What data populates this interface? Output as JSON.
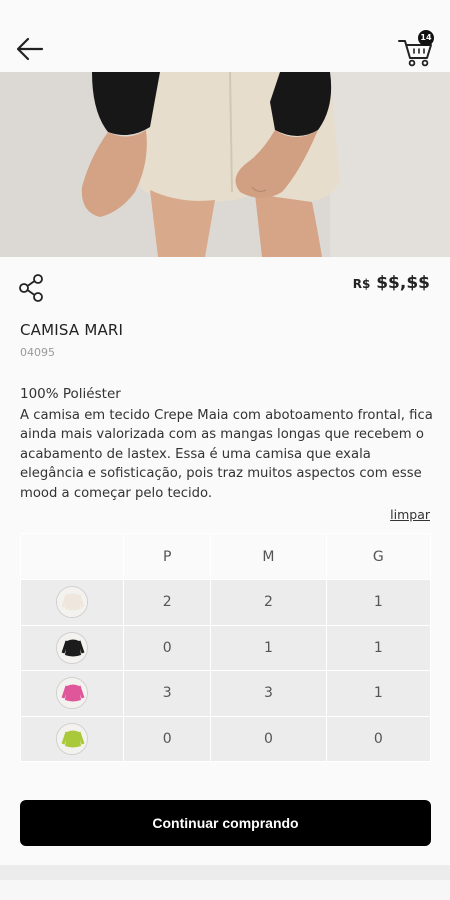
{
  "header": {
    "back_icon": "arrow-left-icon",
    "cart_icon": "shopping-cart-icon",
    "cart_count": "14"
  },
  "gallery": {
    "slide_count": 5,
    "active_index": 1
  },
  "product": {
    "price_currency": "R$",
    "price_value": "$$,$$",
    "name": "CAMISA MARI",
    "code": "04095",
    "material": "100% Poliéster",
    "description": "A camisa em tecido Crepe Maia com abotoamento frontal, fica ainda mais valorizada com as mangas longas que recebem o acabamento de lastex. Essa é uma camisa que exala elegância e sofisticação, pois traz muitos aspectos com esse mood a começar pelo tecido."
  },
  "size_grid": {
    "clear_label": "limpar",
    "headers": [
      "P",
      "M",
      "G"
    ],
    "rows": [
      {
        "color_name": "off-white",
        "swatch": "#efe7dd",
        "values": [
          "2",
          "2",
          "1"
        ]
      },
      {
        "color_name": "black",
        "swatch": "#1c1c1c",
        "values": [
          "0",
          "1",
          "1"
        ]
      },
      {
        "color_name": "pink",
        "swatch": "#e0569a",
        "values": [
          "3",
          "3",
          "1"
        ]
      },
      {
        "color_name": "lime",
        "swatch": "#a9c93a",
        "values": [
          "0",
          "0",
          "0"
        ]
      }
    ]
  },
  "actions": {
    "continue_label": "Continuar comprando"
  }
}
